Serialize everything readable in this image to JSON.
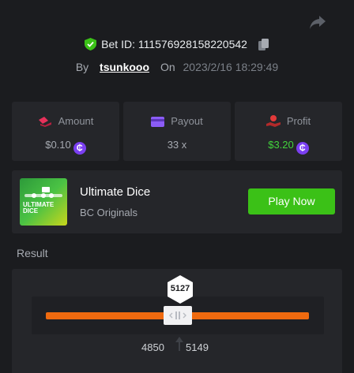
{
  "bet": {
    "label": "Bet ID: ",
    "id": "111576928158220542"
  },
  "by": {
    "label": "By",
    "user": "tsunkooo",
    "on_label": "On",
    "date": "2023/2/16 18:29:49"
  },
  "stats": [
    {
      "label": "Amount",
      "value": "$0.10"
    },
    {
      "label": "Payout",
      "value": "33 x"
    },
    {
      "label": "Profit",
      "value": "$3.20"
    }
  ],
  "game": {
    "name": "Ultimate Dice",
    "provider": "BC Originals",
    "play_label": "Play Now",
    "thumb_text": "ULTIMATE DICE"
  },
  "result": {
    "label": "Result",
    "roll": "5127",
    "range_low": "4850",
    "range_high": "5149"
  },
  "colors": {
    "accent_green": "#3bc117",
    "profit_green": "#42d53c",
    "track_orange": "#ef6a0f",
    "coin_purple": "#7b3ff2",
    "amount_icon": "#e8315b",
    "payout_icon": "#8b5cf6",
    "profit_icon": "#e33a3a"
  },
  "icons": {
    "share": "share-icon",
    "verified": "shield-check-icon",
    "copy": "copy-icon",
    "coin": "bc-coin-icon"
  }
}
